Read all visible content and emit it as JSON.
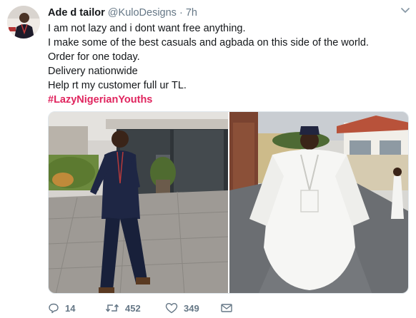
{
  "tweet": {
    "author_name": "Ade d tailor",
    "handle": "@KuloDesigns",
    "separator": "·",
    "time": "7h",
    "lines": [
      "I am not lazy and i dont want free anything.",
      "I make some of the best casuals and agbada on this side of the world.",
      "Order for one today.",
      "Delivery nationwide",
      "Help rt my customer full ur TL."
    ],
    "hashtag": "#LazyNigerianYouths"
  },
  "actions": {
    "replies": "14",
    "retweets": "452",
    "likes": "349"
  },
  "icons": {
    "caret": "chevron-down-icon",
    "reply": "reply-icon",
    "retweet": "retweet-icon",
    "like": "heart-icon",
    "message": "envelope-icon"
  },
  "colors": {
    "hashtag": "#e0245e",
    "meta": "#657786",
    "text": "#14171a"
  }
}
